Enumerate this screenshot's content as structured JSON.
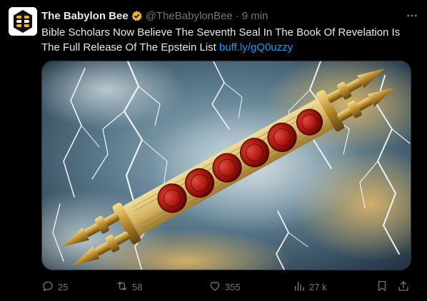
{
  "post": {
    "author_name": "The Babylon Bee",
    "handle": "@TheBabylonBee",
    "separator": "·",
    "time": "9 min",
    "text": "Bible Scholars Now Believe The Seventh Seal In The Book Of Revelation Is The Full Release Of The Epstein List",
    "link": "buff.ly/gQ0uzzy"
  },
  "actions": {
    "replies": "25",
    "reposts": "58",
    "likes": "355",
    "views": "27 k"
  },
  "colors": {
    "link": "#1d9bf0",
    "verified_badge": "#e8b339",
    "muted_text": "#71767b",
    "background": "#000000"
  },
  "icons": [
    "more-icon",
    "verified-icon",
    "reply-icon",
    "repost-icon",
    "like-icon",
    "views-icon",
    "bookmark-icon",
    "share-icon"
  ]
}
